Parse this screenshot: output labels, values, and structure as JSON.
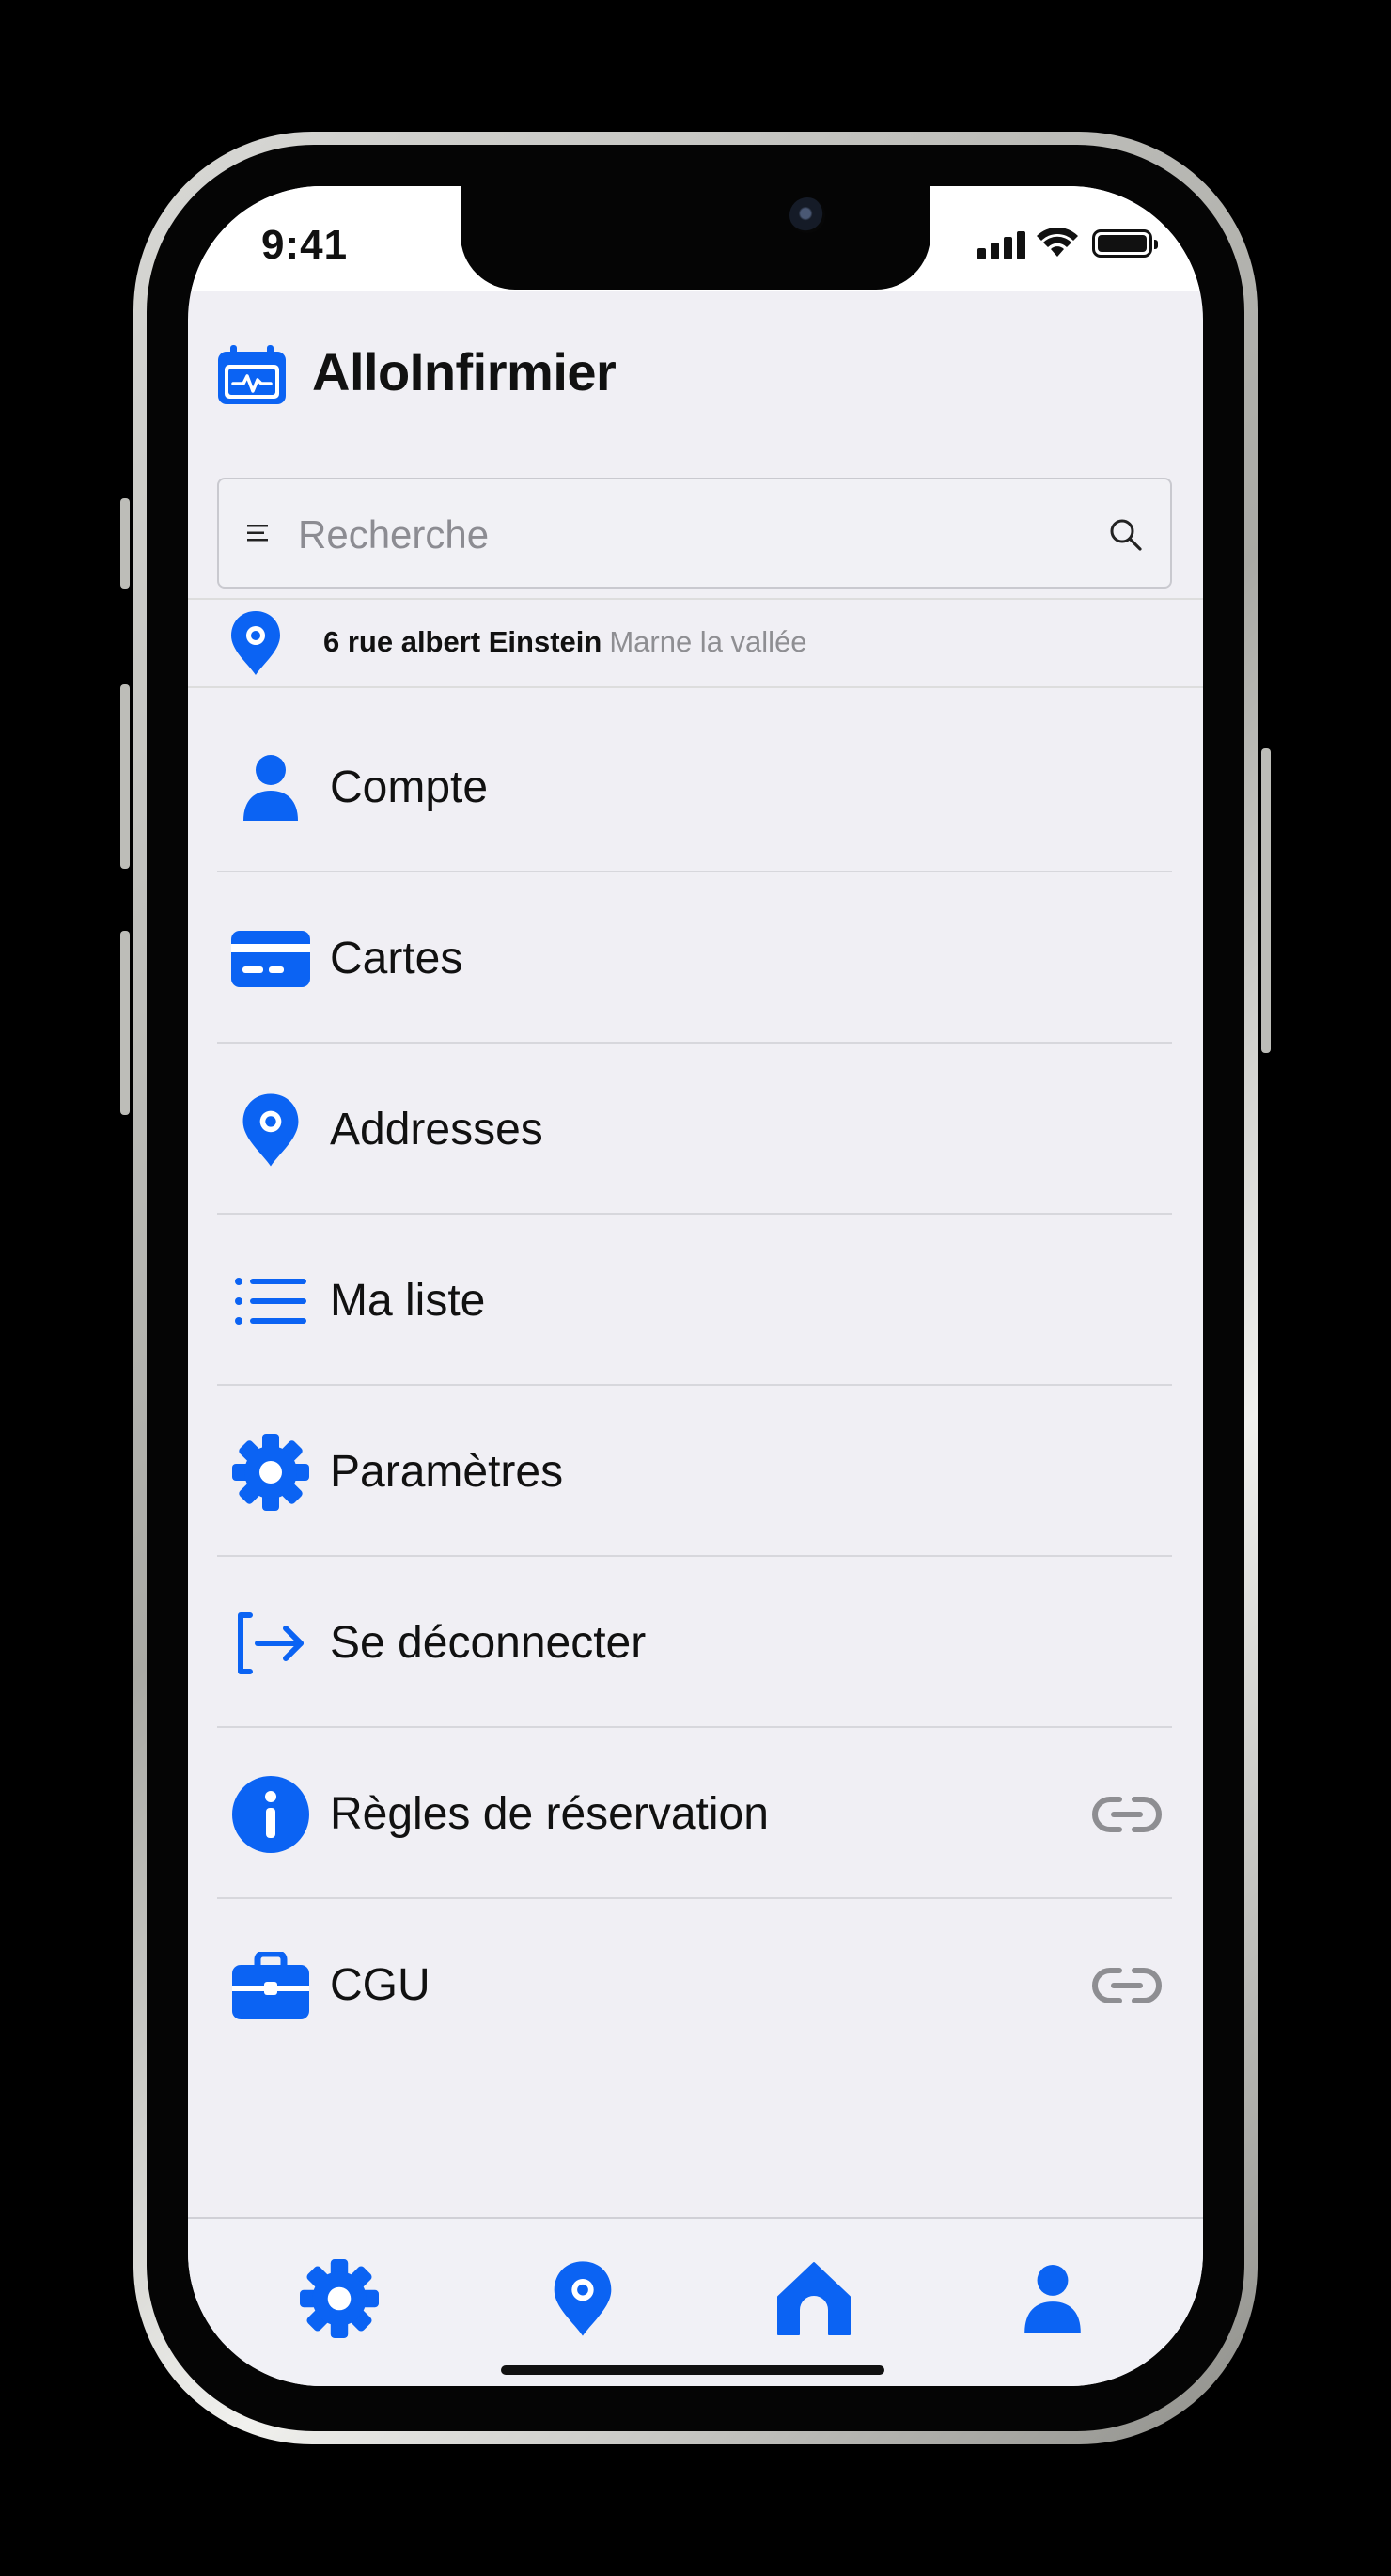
{
  "colors": {
    "accent": "#0b63f3",
    "text": "#111111",
    "muted": "#8e8e92",
    "background": "#f0eff4"
  },
  "status_bar": {
    "time": "9:41"
  },
  "app": {
    "title": "AlloInfirmier",
    "logo_icon": "calendar-heartbeat-icon"
  },
  "search": {
    "placeholder": "Recherche",
    "value": ""
  },
  "address": {
    "street": "6 rue albert Einstein",
    "city": "Marne la vallée"
  },
  "menu": {
    "items": [
      {
        "label": "Compte",
        "icon": "user-icon",
        "link": false
      },
      {
        "label": "Cartes",
        "icon": "credit-card-icon",
        "link": false
      },
      {
        "label": "Addresses",
        "icon": "location-pin-icon",
        "link": false
      },
      {
        "label": "Ma liste",
        "icon": "list-icon",
        "link": false
      },
      {
        "label": "Paramètres",
        "icon": "gear-icon",
        "link": false
      },
      {
        "label": "Se déconnecter",
        "icon": "logout-icon",
        "link": false
      },
      {
        "label": "Règles de réservation",
        "icon": "info-icon",
        "link": true
      },
      {
        "label": "CGU",
        "icon": "briefcase-icon",
        "link": true
      }
    ]
  },
  "tabbar": {
    "tabs": [
      {
        "icon": "gear-icon"
      },
      {
        "icon": "location-pin-icon"
      },
      {
        "icon": "home-icon"
      },
      {
        "icon": "user-icon"
      }
    ]
  }
}
